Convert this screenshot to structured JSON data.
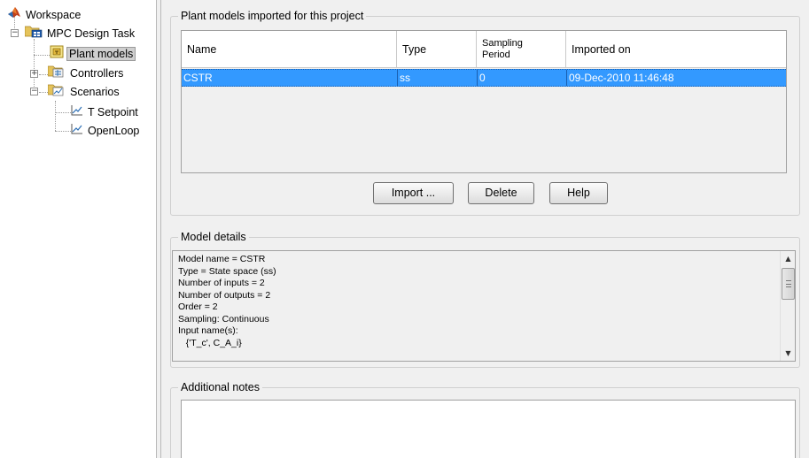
{
  "tree": {
    "items": [
      {
        "label": "Workspace",
        "icon": "matlab-logo-icon"
      },
      {
        "label": "MPC Design Task",
        "icon": "mpc-task-icon"
      },
      {
        "label": "Plant models",
        "icon": "plant-models-icon"
      },
      {
        "label": "Controllers",
        "icon": "controllers-icon"
      },
      {
        "label": "Scenarios",
        "icon": "scenarios-icon"
      },
      {
        "label": "T Setpoint",
        "icon": "scenario-plot-icon"
      },
      {
        "label": "OpenLoop",
        "icon": "scenario-plot-icon"
      }
    ]
  },
  "plant_models": {
    "title": "Plant models imported for this project",
    "columns": [
      "Name",
      "Type",
      "Sampling\nPeriod",
      "Imported on"
    ],
    "rows": [
      {
        "name": "CSTR",
        "type": "ss",
        "sampling": "0",
        "imported_on": "09-Dec-2010 11:46:48"
      }
    ],
    "buttons": {
      "import": "Import ...",
      "delete": "Delete",
      "help": "Help"
    }
  },
  "model_details": {
    "title": "Model details",
    "lines": [
      "Model name = CSTR",
      "Type = State space (ss)",
      "Number of inputs = 2",
      "Number of outputs = 2",
      "Order = 2",
      "Sampling: Continuous",
      "Input name(s):",
      "   {'T_c', C_A_i}"
    ]
  },
  "additional_notes": {
    "title": "Additional notes",
    "value": ""
  },
  "colors": {
    "selection": "#3399ff",
    "panel_bg": "#f0f0f0"
  }
}
